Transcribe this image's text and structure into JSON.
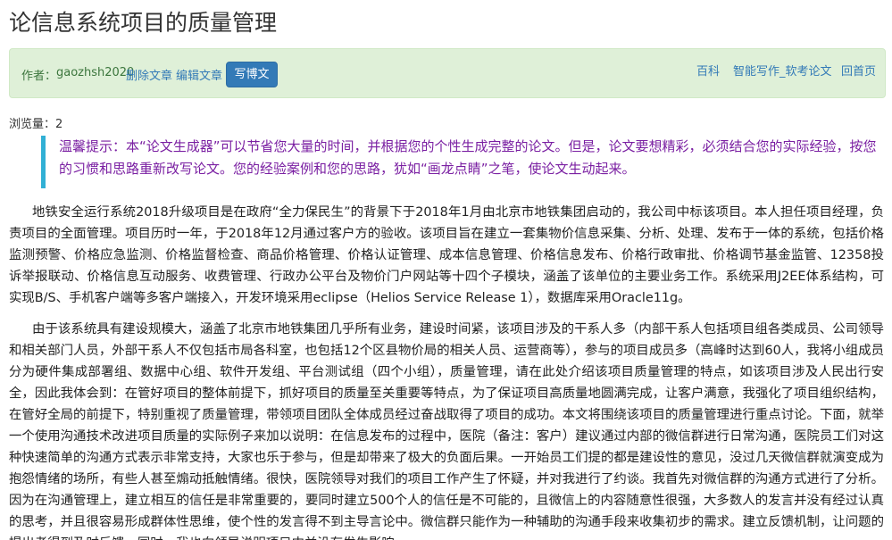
{
  "page": {
    "title": "论信息系统项目的质量管理"
  },
  "toolbar": {
    "author_label": "作者：",
    "author_name": "gaozhsh2020",
    "delete_label": "删除文章",
    "edit_label": "编辑文章",
    "write_label": "写博文",
    "nav_baike": "百科",
    "nav_ai": "智能写作_软考论文",
    "nav_home": "回首页"
  },
  "meta": {
    "views": "浏览量：2"
  },
  "tip": {
    "text": "温馨提示：本“论文生成器”可以节省您大量的时间，并根据您的个性生成完整的论文。但是，论文要想精彩，必须结合您的实际经验，按您的习惯和思路重新改写论文。您的经验案例和您的思路，犹如“画龙点睛”之笔，使论文生动起来。"
  },
  "article": {
    "paragraphs": [
      "地铁安全运行系统2018升级项目是在政府“全力保民生”的背景下于2018年1月由北京市地铁集团启动的，我公司中标该项目。本人担任项目经理，负责项目的全面管理。项目历时一年，于2018年12月通过客户方的验收。该项目旨在建立一套集物价信息采集、分析、处理、发布于一体的系统，包括价格监测预警、价格应急监测、价格监督检查、商品价格管理、价格认证管理、成本信息管理、价格信息发布、价格行政审批、价格调节基金监管、12358投诉举报联动、价格信息互动服务、收费管理、行政办公平台及物价门户网站等十四个子模块，涵盖了该单位的主要业务工作。系统采用J2EE体系结构，可实现B/S、手机客户端等多客户端接入，开发环境采用eclipse（Helios Service Release 1），数据库采用Oracle11g。",
      "由于该系统具有建设规模大，涵盖了北京市地铁集团几乎所有业务，建设时间紧，该项目涉及的干系人多（内部干系人包括项目组各类成员、公司领导和相关部门人员，外部干系人不仅包括市局各科室，也包括12个区县物价局的相关人员、运营商等），参与的项目成员多（高峰时达到60人，我将小组成员分为硬件集成部署组、数据中心组、软件开发组、平台测试组（四个小组），质量管理，请在此处介绍该项目质量管理的特点，如该项目涉及人民出行安全，因此我体会到：在管好项目的整体前提下，抓好项目的质量至关重要等特点，为了保证项目高质量地圆满完成，让客户满意，我强化了项目组织结构，在管好全局的前提下，特别重视了质量管理，带领项目团队全体成员经过奋战取得了项目的成功。本文将围绕该项目的质量管理进行重点讨论。下面，就举一个使用沟通技术改进项目质量的实际例子来加以说明：在信息发布的过程中，医院（备注：客户）建议通过内部的微信群进行日常沟通，医院员工们对这种快速简单的沟通方式表示非常支持，大家也乐于参与，但是却带来了极大的负面后果。一开始员工们提的都是建设性的意见，没过几天微信群就演变成为抱怨情绪的场所，有些人甚至煽动抵触情绪。很快，医院领导对我们的项目工作产生了怀疑，并对我进行了约谈。我首先对微信群的沟通方式进行了分析。因为在沟通管理上，建立相互的信任是非常重要的，要同时建立500个人的信任是不可能的，且微信上的内容随意性很强，大多数人的发言并没有经过认真的思考，并且很容易形成群体性思维，使个性的发言得不到主导言论中。微信群只能作为一种辅助的沟通手段来收集初步的需求。建立反馈机制，让问题的提出者得到及时反馈。同时，我也向领导说明项目中并没有发生影响"
    ]
  }
}
